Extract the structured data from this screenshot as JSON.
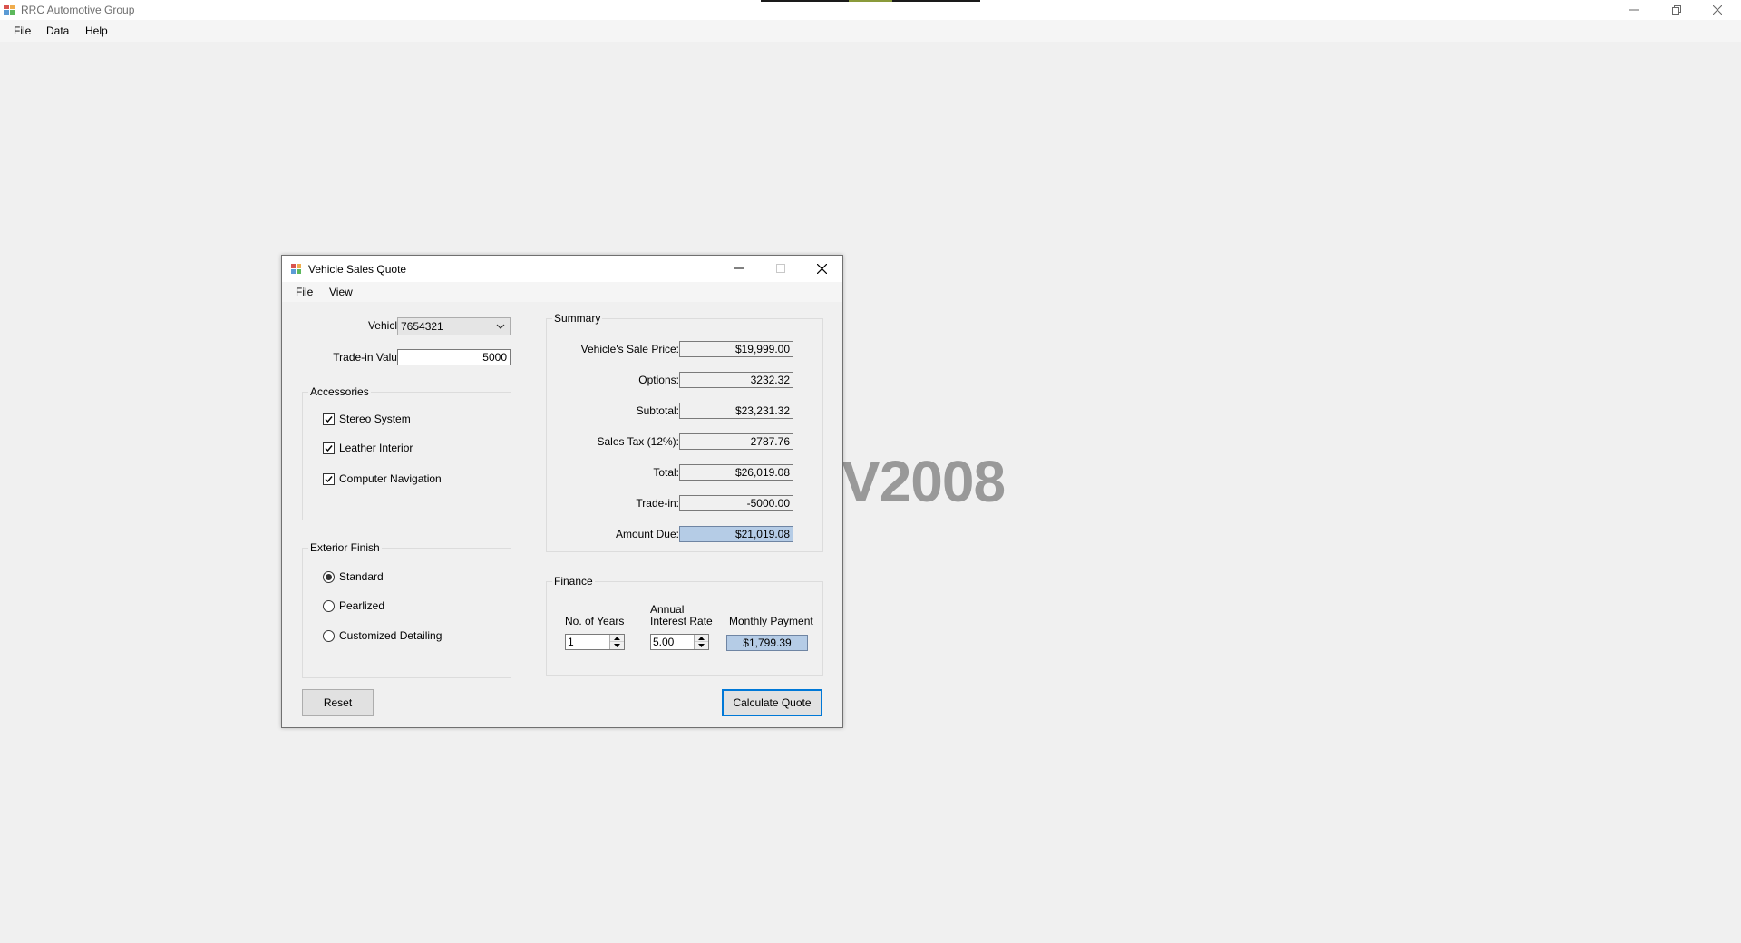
{
  "app": {
    "title": "RRC Automotive Group",
    "menu": [
      "File",
      "Data",
      "Help"
    ]
  },
  "watermark": "V2008",
  "quote_window": {
    "title": "Vehicle Sales Quote",
    "menu": [
      "File",
      "View"
    ],
    "vehicle": {
      "label": "Vehicle:",
      "value": "7654321"
    },
    "trade_in": {
      "label": "Trade-in Value:",
      "value": "5000"
    },
    "accessories": {
      "title": "Accessories",
      "items": [
        {
          "label": "Stereo System",
          "checked": true
        },
        {
          "label": "Leather Interior",
          "checked": true
        },
        {
          "label": "Computer Navigation",
          "checked": true
        }
      ]
    },
    "exterior_finish": {
      "title": "Exterior Finish",
      "options": [
        {
          "label": "Standard",
          "selected": true
        },
        {
          "label": "Pearlized",
          "selected": false
        },
        {
          "label": "Customized Detailing",
          "selected": false
        }
      ]
    },
    "summary": {
      "title": "Summary",
      "rows": [
        {
          "label": "Vehicle's Sale Price:",
          "value": "$19,999.00"
        },
        {
          "label": "Options:",
          "value": "3232.32"
        },
        {
          "label": "Subtotal:",
          "value": "$23,231.32"
        },
        {
          "label": "Sales Tax (12%):",
          "value": "2787.76"
        },
        {
          "label": "Total:",
          "value": "$26,019.08"
        },
        {
          "label": "Trade-in:",
          "value": "-5000.00"
        },
        {
          "label": "Amount Due:",
          "value": "$21,019.08"
        }
      ]
    },
    "finance": {
      "title": "Finance",
      "years_label": "No. of Years",
      "years_value": "1",
      "rate_label_1": "Annual",
      "rate_label_2": "Interest Rate",
      "rate_value": "5.00",
      "payment_label": "Monthly Payment",
      "payment_value": "$1,799.39"
    },
    "reset_label": "Reset",
    "calculate_label": "Calculate Quote"
  },
  "colors": {
    "highlight": "#b5cce6",
    "default_button_border": "#0078d7"
  }
}
